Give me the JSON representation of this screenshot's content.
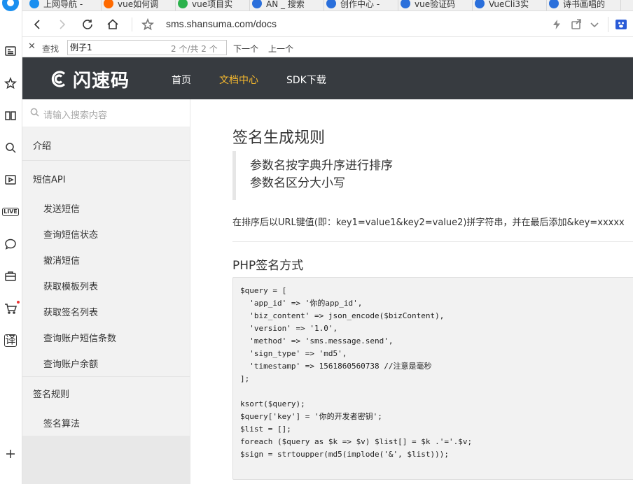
{
  "browser": {
    "tabs": [
      {
        "label": "上网导航 -",
        "color": "#1a8ff0"
      },
      {
        "label": "vue如何调",
        "color": "#ff6a00"
      },
      {
        "label": "vue项目实",
        "color": "#2bb24c"
      },
      {
        "label": "AN _ 搜索",
        "color": "#2a6fdb"
      },
      {
        "label": "创作中心 -",
        "color": "#2a6fdb"
      },
      {
        "label": "vue验证码",
        "color": "#2a6fdb"
      },
      {
        "label": "VueCli3实",
        "color": "#2a6fdb"
      },
      {
        "label": "诗书画唱的",
        "color": "#2a6fdb"
      }
    ],
    "url": "sms.shansuma.com/docs",
    "rail_icons": [
      "browser-logo-icon",
      "news-icon",
      "star-icon",
      "book-icon",
      "search-icon",
      "video-icon",
      "live-icon",
      "chat-icon",
      "mail-icon",
      "cart-icon",
      "translate-icon",
      "add-icon"
    ],
    "live_text": "LIVE",
    "translate_text": "译"
  },
  "find": {
    "label": "查找",
    "query": "例子1",
    "count": "2 个/共 2 个",
    "next": "下一个",
    "prev": "上一个"
  },
  "site": {
    "logo_text": "闪速码",
    "nav": [
      {
        "label": "首页",
        "active": false
      },
      {
        "label": "文档中心",
        "active": true
      },
      {
        "label": "SDK下载",
        "active": false
      }
    ],
    "accent_color": "#f5b82e",
    "header_color": "#373b40"
  },
  "sidebar": {
    "search_placeholder": "请输入搜索内容",
    "intro": "介绍",
    "sms_api": "短信API",
    "sms_items": [
      "发送短信",
      "查询短信状态",
      "撤消短信",
      "获取模板列表",
      "获取签名列表",
      "查询账户短信条数",
      "查询账户余额"
    ],
    "sign_rules": "签名规则",
    "sign_items": [
      "签名算法"
    ]
  },
  "content": {
    "title": "签名生成规则",
    "quote_lines": [
      "参数名按字典升序进行排序",
      "参数名区分大小写"
    ],
    "paragraph": "在排序后以URL键值(即：key1=value1&key2=value2)拼字符串，并在最后添加&key=xxxxx",
    "subtitle": "PHP签名方式",
    "code": "$query = [\n  'app_id' => '你的app_id',\n  'biz_content' => json_encode($bizContent),\n  'version' => '1.0',\n  'method' => 'sms.message.send',\n  'sign_type' => 'md5',\n  'timestamp' => 1561860560738 //注意是毫秒\n];\n\nksort($query);\n$query['key'] = '你的开发者密钥';\n$list = [];\nforeach ($query as $k => $v) $list[] = $k .'='.$v;\n$sign = strtoupper(md5(implode('&', $list)));"
  }
}
